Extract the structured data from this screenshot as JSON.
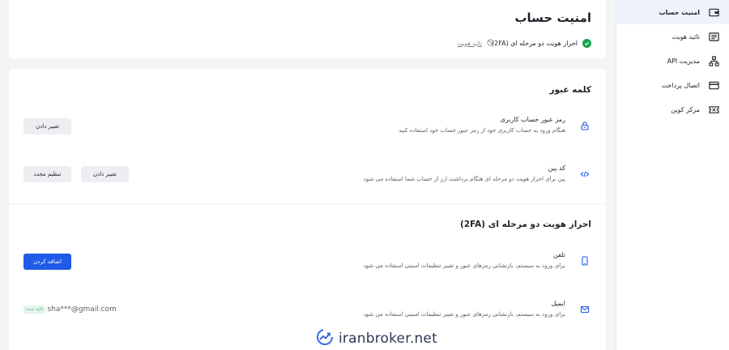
{
  "sidebar": {
    "items": [
      {
        "label": "امنیت حساب",
        "icon": "wallet-icon",
        "active": true
      },
      {
        "label": "تائید هویت",
        "icon": "id-card-icon",
        "active": false
      },
      {
        "label": "مدیریت API",
        "icon": "network-icon",
        "active": false
      },
      {
        "label": "اتصال پرداخت",
        "icon": "credit-card-icon",
        "active": false
      },
      {
        "label": "مرکز کوپن",
        "icon": "ticket-icon",
        "active": false
      }
    ]
  },
  "header": {
    "title": "امنیت حساب",
    "twofa_status": "احراز هویت دو مرحله ای (2FA)",
    "kyc_status": "تائید هویت"
  },
  "password_section": {
    "title": "کلمه عبور",
    "rows": [
      {
        "title": "رمز عبور حساب کاربری",
        "desc": "هنگام ورود به حساب کاربری خود از رمز عبور حساب خود استفاده کنید",
        "icon": "lock-icon",
        "buttons": [
          "تغییر دادن"
        ]
      },
      {
        "title": "کد پین",
        "desc": "پین برای احراز هویت دو مرحله ای هنگام برداشت ارز از حساب شما استفاده می شود",
        "icon": "code-icon",
        "buttons": [
          "تغییر دادن",
          "تنظیم مجدد"
        ]
      }
    ]
  },
  "twofa_section": {
    "title": "احراز هویت دو مرحله ای (2FA)",
    "rows": [
      {
        "title": "تلفن",
        "desc": "برای ورود به سیستم، بازنشانی رمزهای عبور و تغییر تنظیمات امنیتی استفاده می شود",
        "icon": "phone-icon",
        "button": "اضافه کردن"
      },
      {
        "title": "ایمیل",
        "desc": "برای ورود به سیستم، بازنشانی رمزهای عبور و تغییر تنظیمات امنیتی استفاده می شود",
        "icon": "mail-icon",
        "value": "sha***@gmail.com",
        "badge": "تائید شده"
      }
    ]
  },
  "watermark": {
    "text": "iranbroker.net",
    "icon": "chart-logo-icon"
  },
  "colors": {
    "accent": "#1f5ae8",
    "success": "#16a34a",
    "sidebar_active_bg": "#eef2fb"
  }
}
